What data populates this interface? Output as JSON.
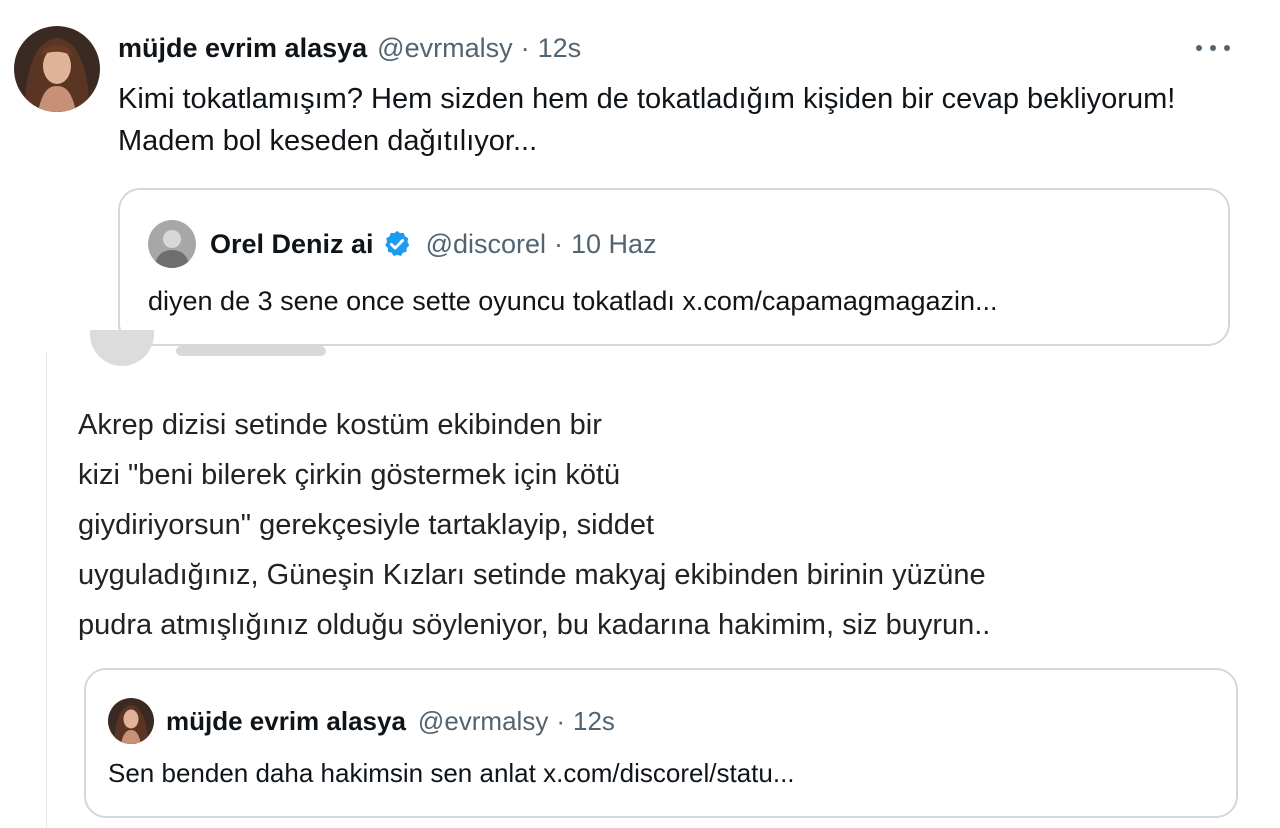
{
  "main_tweet": {
    "author_name": "müjde evrim alasya",
    "author_handle": "@evrmalsy",
    "separator": "·",
    "time": "12s",
    "text": "Kimi tokatlamışım? Hem sizden hem de tokatladığım kişiden bir cevap bekliyorum! Madem bol keseden dağıtılıyor...",
    "more_icon": "more-horizontal-icon",
    "quoted_tweet": {
      "author_name": "Orel Deniz ai",
      "verified_icon": "verified-badge-icon",
      "author_handle": "@discorel",
      "separator": "·",
      "time": "10 Haz",
      "text": "diyen de 3 sene once sette oyuncu tokatladı x.com/capamagmagazin..."
    }
  },
  "reply_tweet": {
    "text_lines": [
      "Akrep dizisi setinde kostüm ekibinden bir",
      "kizi \"beni bilerek çirkin göstermek için kötü",
      "giydiriyorsun\" gerekçesiyle tartaklayip, siddet",
      "uyguladığınız, Güneşin Kızları setinde makyaj ekibinden birinin yüzüne",
      "pudra atmışlığınız olduğu söyleniyor, bu kadarına hakimim, siz buyrun.."
    ],
    "quoted_tweet": {
      "author_name": "müjde evrim alasya",
      "author_handle": "@evrmalsy",
      "separator": "·",
      "time": "12s",
      "text": "Sen benden daha hakimsin sen anlat x.com/discorel/statu..."
    }
  },
  "colors": {
    "text_primary": "#0f1419",
    "text_secondary": "#536471",
    "border": "#cfd9de",
    "verified_blue": "#1d9bf0"
  }
}
